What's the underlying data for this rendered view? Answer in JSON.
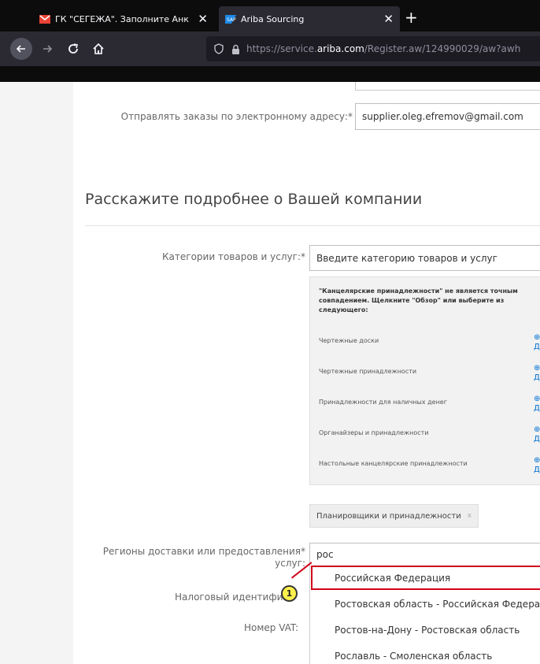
{
  "browser": {
    "tabs": [
      {
        "title": "ГК \"СЕГЕЖА\". Заполните Анк",
        "icon": "gmail-icon",
        "active": false
      },
      {
        "title": "Ariba Sourcing",
        "icon": "sap-icon",
        "active": true
      }
    ],
    "new_tab_symbol": "+",
    "close_symbol": "✕",
    "url": {
      "prefix": "https://service.",
      "host": "ariba.com",
      "suffix": "/Register.aw/124990029/aw?awh"
    }
  },
  "form": {
    "email_label": "Отправлять заказы по электронному адресу:*",
    "email_value": "supplier.oleg.efremov@gmail.com",
    "section_title": "Расскажите подробнее о Вашей компании",
    "categories_label": "Категории товаров и услуг:*",
    "categories_placeholder": "Введите категорию товаров и услуг",
    "categories_note": "\"Канцелярские принадлежности\" не является точным совпадением. Щелкните \"Обзор\" или выберите из следующего:",
    "category_suggestions": [
      "Чертежные доски",
      "Чертежные принадлежности",
      "Принадлежности для наличных денег",
      "Органайзеры и принадлежности",
      "Настольные канцелярские принадлежности"
    ],
    "suggestion_action_symbol": "⊕",
    "suggestion_action_letter": "Д",
    "selected_chip": "Планировщики и принадлежности",
    "chip_remove": "x",
    "regions_label_line1": "Регионы доставки или предоставления*",
    "regions_label_line2": "услуг:",
    "regions_value": "рос",
    "region_options": [
      "Российская Федерация",
      "Ростовская область - Российская Федерац",
      "Ростов-на-Дону - Ростовская область",
      "Рославль - Смоленская область"
    ],
    "tax_id_label": "Налоговый идентифика",
    "vat_label": "Номер VAT:"
  },
  "callout_number": "1",
  "colors": {
    "highlight": "#d0021b",
    "callout_fill": "#fff14d",
    "link": "#0070d2"
  }
}
